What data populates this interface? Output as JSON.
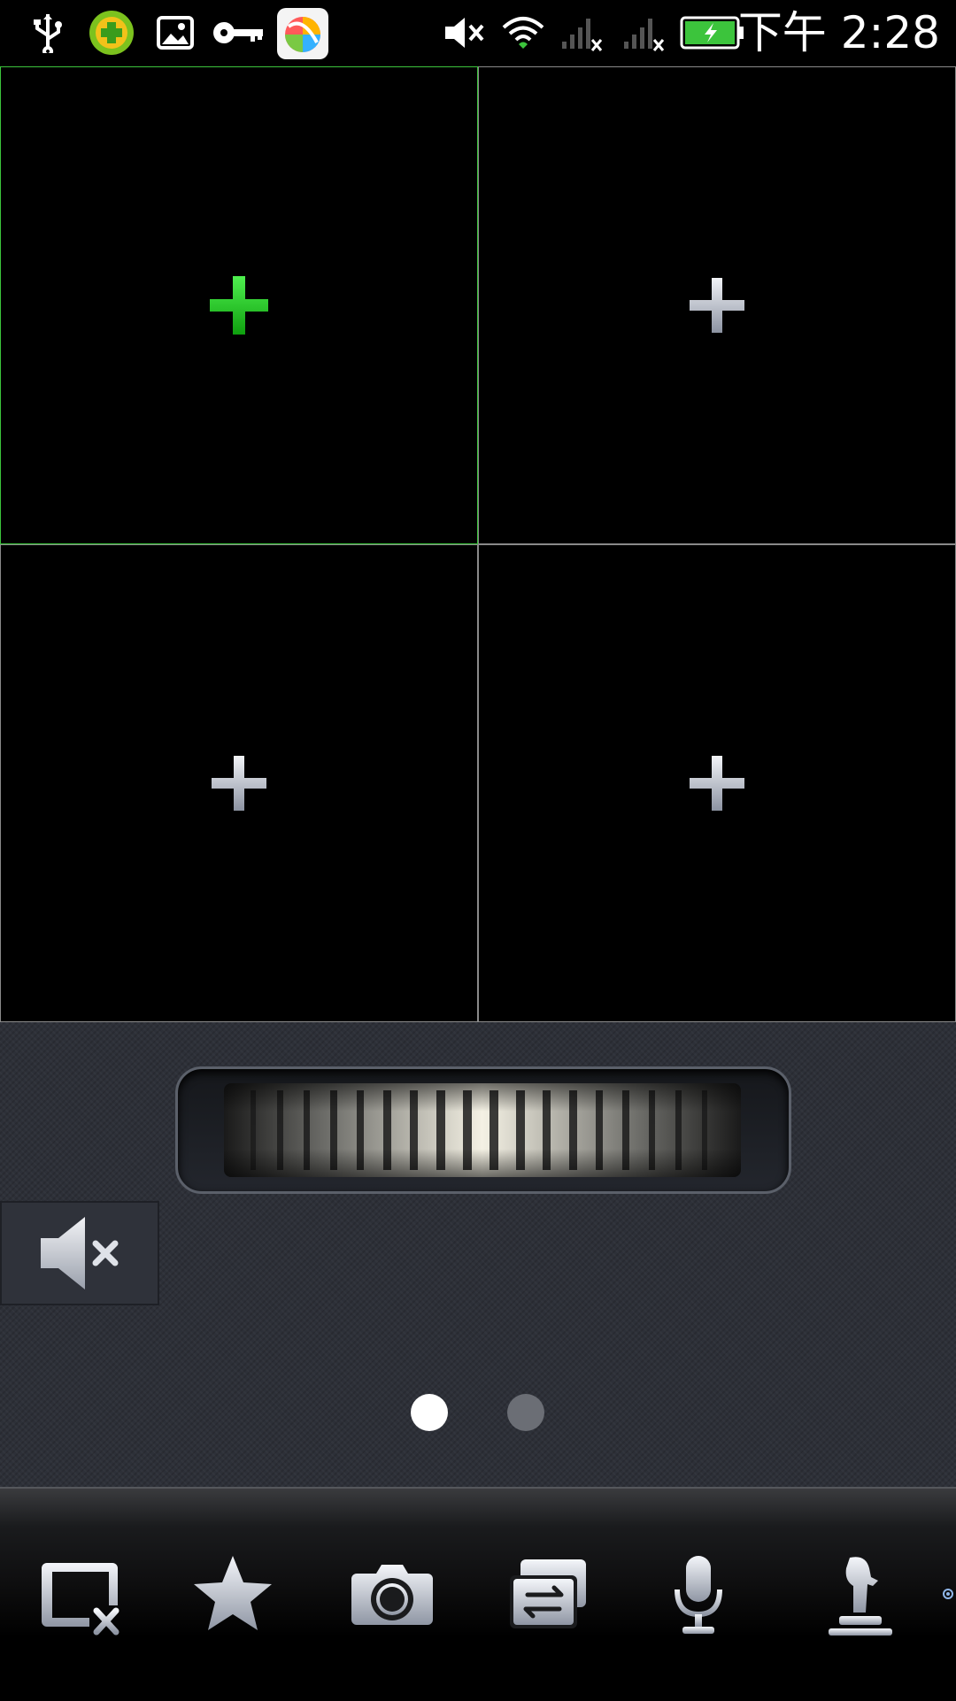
{
  "status_bar": {
    "time": "下午 2:28",
    "icons": [
      "usb-icon",
      "security-app-icon",
      "image-icon",
      "key-icon",
      "app-store-icon",
      "mute-status-icon",
      "wifi-icon",
      "signal-1-no-service-icon",
      "signal-2-no-service-icon",
      "battery-charging-icon"
    ]
  },
  "grid": {
    "cells": [
      {
        "name": "video-cell-1",
        "icon": "add-camera-icon",
        "active": true
      },
      {
        "name": "video-cell-2",
        "icon": "add-camera-icon",
        "active": false
      },
      {
        "name": "video-cell-3",
        "icon": "add-camera-icon",
        "active": false
      },
      {
        "name": "video-cell-4",
        "icon": "add-camera-icon",
        "active": false
      }
    ]
  },
  "controls": {
    "ptz_wheel": "ptz-scroll-wheel",
    "mute_button": "speaker-muted-icon",
    "page_indicator": {
      "pages": 2,
      "current": 1
    }
  },
  "toolbar": {
    "buttons": [
      "close-window-icon",
      "favorite-star-icon",
      "snapshot-camera-icon",
      "switch-stream-icon",
      "microphone-icon",
      "ptz-control-icon"
    ]
  },
  "colors": {
    "active_border": "#3cc43c",
    "active_plus": "#22cc22",
    "inactive_plus": "#c8ccd4",
    "panel_bg": "#2d3038"
  }
}
